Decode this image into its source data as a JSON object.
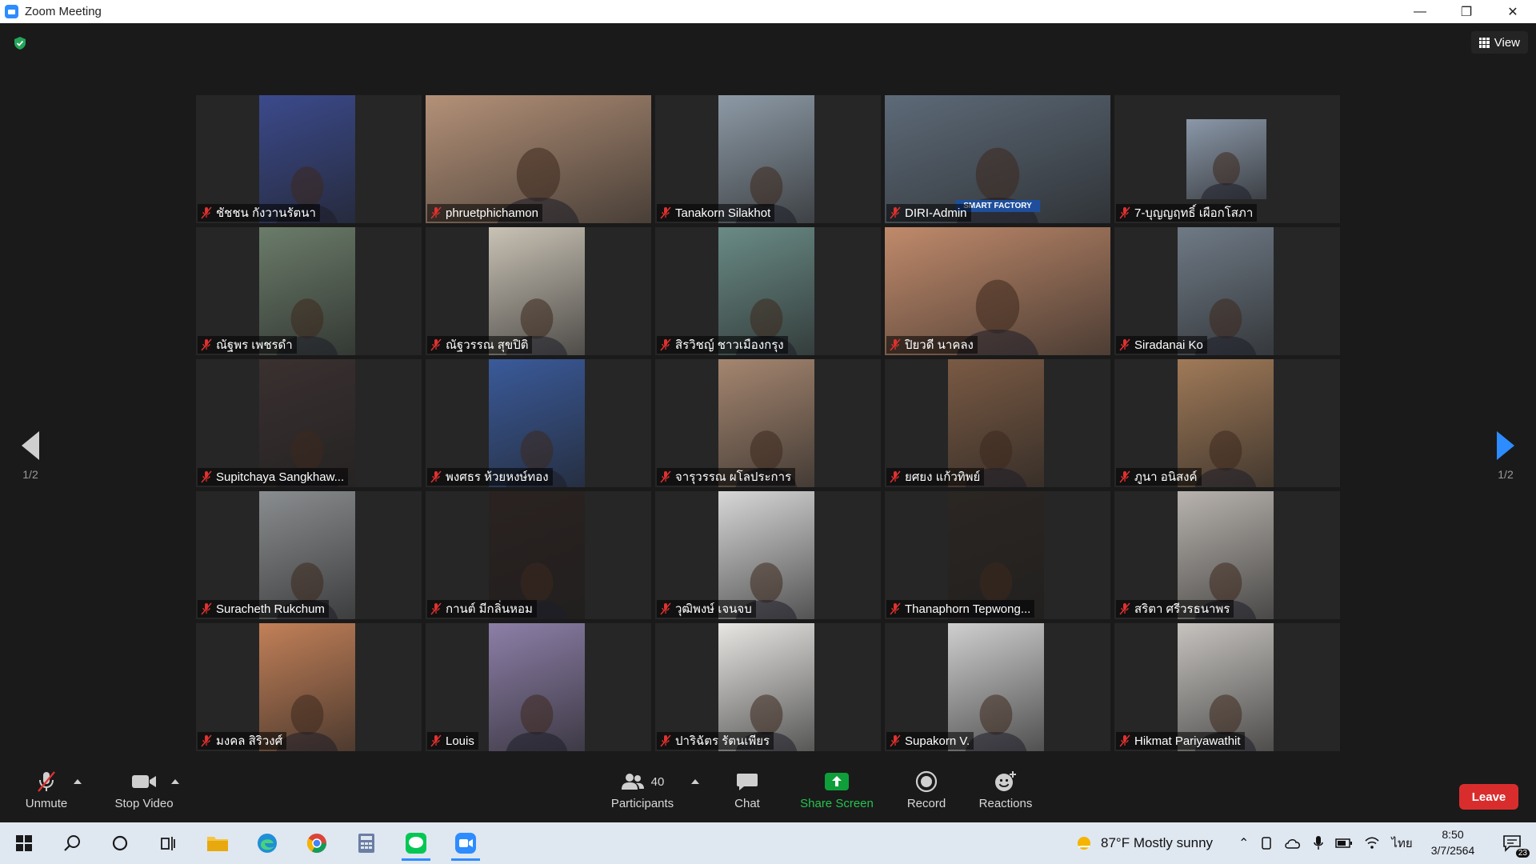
{
  "window": {
    "title": "Zoom Meeting",
    "minimize": "—",
    "restore": "❐",
    "close": "✕"
  },
  "header": {
    "view_label": "View"
  },
  "pager": {
    "left_label": "1/2",
    "right_label": "1/2"
  },
  "participants": [
    {
      "name": "ชัชชน กังวานรัตนา",
      "video": "narrow",
      "bg": "#3b4a8c"
    },
    {
      "name": "phruetphichamon",
      "video": "full",
      "bg": "#b49178"
    },
    {
      "name": "Tanakorn Silakhot",
      "video": "narrow",
      "bg": "#8d9aa6"
    },
    {
      "name": "DIRI-Admin",
      "video": "full",
      "bg": "#5d6a78",
      "active": true,
      "banner": "SMART FACTORY"
    },
    {
      "name": "7-บุญญฤทธิ์ เผือกโสภา",
      "video": "small",
      "bg": "#8b98a9"
    },
    {
      "name": "ณัฐพร เพชรดำ",
      "video": "narrow",
      "bg": "#6b7c6a"
    },
    {
      "name": "ณัฐวรรณ สุขปิติ",
      "video": "narrow",
      "bg": "#c9c2b5"
    },
    {
      "name": "สิรวิชญ์ ชาวเมืองกรุง",
      "video": "narrow",
      "bg": "#6a8b86"
    },
    {
      "name": "ปิยวดี นาคลง",
      "video": "full",
      "bg": "#c08a6b"
    },
    {
      "name": "Siradanai Ko",
      "video": "narrow",
      "bg": "#6f7a86"
    },
    {
      "name": "Supitchaya Sangkhaw...",
      "video": "narrow",
      "bg": "#3a3030"
    },
    {
      "name": "พงศธร ห้วยหงษ์ทอง",
      "video": "narrow",
      "bg": "#3a5a9a"
    },
    {
      "name": "จารุวรรณ ผโลประการ",
      "video": "narrow",
      "bg": "#a58670"
    },
    {
      "name": "ยศยง แก้วทิพย์",
      "video": "narrow",
      "bg": "#7a5a44"
    },
    {
      "name": "ภูนา อนิสงค์",
      "video": "narrow",
      "bg": "#a07a58"
    },
    {
      "name": "Suracheth Rukchum",
      "video": "narrow",
      "bg": "#8a8d8f"
    },
    {
      "name": "กานต์ มีกลิ่นหอม",
      "video": "narrow",
      "bg": "#2a2220"
    },
    {
      "name": "วุฒิพงษ์ เจนจบ",
      "video": "narrow",
      "bg": "#d7d7d7"
    },
    {
      "name": "Thanaphorn Tepwong...",
      "video": "narrow",
      "bg": "#2b2622"
    },
    {
      "name": "สริตา ศรีวรธนาพร",
      "video": "narrow",
      "bg": "#b8b3ae"
    },
    {
      "name": "มงคล สิริวงศ์",
      "video": "narrow",
      "bg": "#c28058"
    },
    {
      "name": "Louis",
      "video": "narrow",
      "bg": "#8d7fa8"
    },
    {
      "name": "ปาริฉัตร รัตนเพียร",
      "video": "narrow",
      "bg": "#e7e6e3"
    },
    {
      "name": "Supakorn V.",
      "video": "narrow",
      "bg": "#d0cfcf"
    },
    {
      "name": "Hikmat Pariyawathit",
      "video": "narrow",
      "bg": "#c6c3bf"
    }
  ],
  "toolbar": {
    "unmute": "Unmute",
    "stop_video": "Stop Video",
    "participants": "Participants",
    "participants_count": "40",
    "chat": "Chat",
    "share_screen": "Share Screen",
    "record": "Record",
    "reactions": "Reactions",
    "leave": "Leave"
  },
  "taskbar": {
    "weather": "87°F  Mostly sunny",
    "language": "ไทย",
    "time": "8:50",
    "date": "3/7/2564",
    "notifications": "23"
  },
  "colors": {
    "accent": "#2d8cff",
    "share_green": "#0e9f3a",
    "leave_red": "#d92d2d",
    "active_border": "#c8e033"
  }
}
